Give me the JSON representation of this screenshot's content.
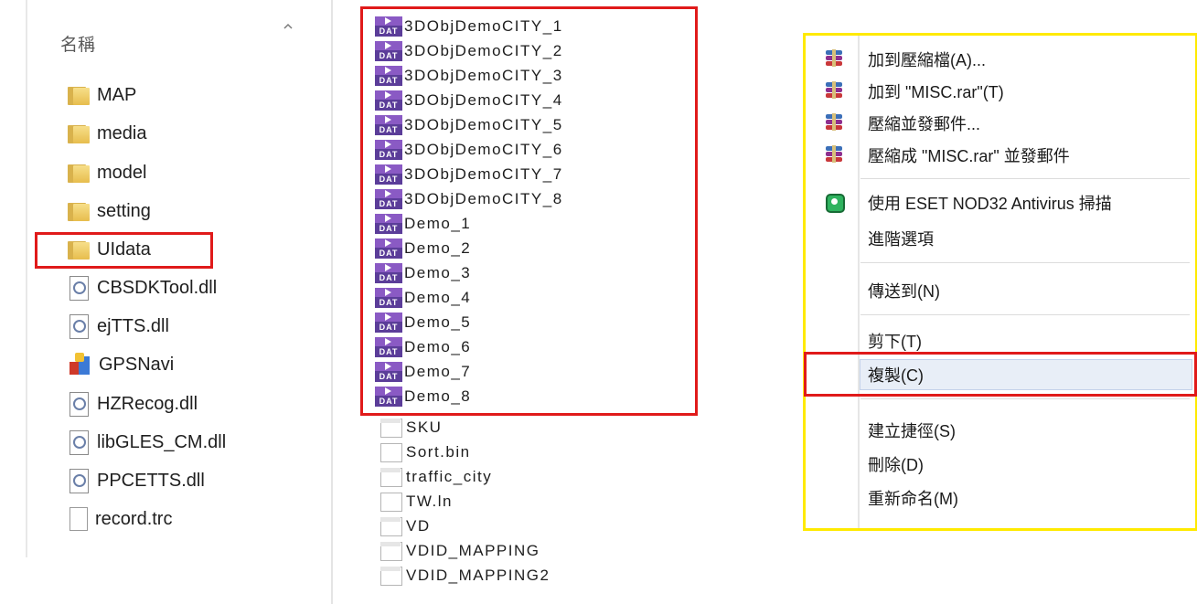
{
  "left_panel": {
    "column_header": "名稱",
    "items": [
      {
        "label": "MAP",
        "icon": "folder-icon",
        "kind": "folder"
      },
      {
        "label": "media",
        "icon": "folder-icon",
        "kind": "folder"
      },
      {
        "label": "model",
        "icon": "folder-icon",
        "kind": "folder"
      },
      {
        "label": "setting",
        "icon": "folder-icon",
        "kind": "folder"
      },
      {
        "label": "UIdata",
        "icon": "folder-icon",
        "kind": "folder",
        "highlighted": true
      },
      {
        "label": "CBSDKTool.dll",
        "icon": "dll-file-icon",
        "kind": "dll"
      },
      {
        "label": "ejTTS.dll",
        "icon": "dll-file-icon",
        "kind": "dll"
      },
      {
        "label": "GPSNavi",
        "icon": "application-icon",
        "kind": "exe"
      },
      {
        "label": "HZRecog.dll",
        "icon": "dll-file-icon",
        "kind": "dll"
      },
      {
        "label": "libGLES_CM.dll",
        "icon": "dll-file-icon",
        "kind": "dll"
      },
      {
        "label": "PPCETTS.dll",
        "icon": "dll-file-icon",
        "kind": "dll"
      },
      {
        "label": "record.trc",
        "icon": "file-icon",
        "kind": "file"
      }
    ]
  },
  "middle_panel": {
    "dat_icon_text": "DAT",
    "dat_files": [
      "3DObjDemoCITY_1",
      "3DObjDemoCITY_2",
      "3DObjDemoCITY_3",
      "3DObjDemoCITY_4",
      "3DObjDemoCITY_5",
      "3DObjDemoCITY_6",
      "3DObjDemoCITY_7",
      "3DObjDemoCITY_8",
      "Demo_1",
      "Demo_2",
      "Demo_3",
      "Demo_4",
      "Demo_5",
      "Demo_6",
      "Demo_7",
      "Demo_8"
    ],
    "other_files": [
      "SKU",
      "Sort.bin",
      "traffic_city",
      "TW.ln",
      "VD",
      "VDID_MAPPING",
      "VDID_MAPPING2"
    ]
  },
  "context_menu": {
    "groups": [
      [
        {
          "label": "加到壓縮檔(A)...",
          "icon": "winrar-icon"
        },
        {
          "label": "加到 \"MISC.rar\"(T)",
          "icon": "winrar-icon"
        },
        {
          "label": "壓縮並發郵件...",
          "icon": "winrar-icon"
        },
        {
          "label": "壓縮成 \"MISC.rar\" 並發郵件",
          "icon": "winrar-icon"
        }
      ],
      [
        {
          "label": "使用 ESET NOD32 Antivirus 掃描",
          "icon": "eset-icon"
        },
        {
          "label": "進階選項",
          "icon": ""
        }
      ],
      [
        {
          "label": "傳送到(N)",
          "icon": ""
        }
      ],
      [
        {
          "label": "剪下(T)",
          "icon": ""
        },
        {
          "label": "複製(C)",
          "icon": "",
          "highlighted": true
        }
      ],
      [
        {
          "label": "建立捷徑(S)",
          "icon": ""
        },
        {
          "label": "刪除(D)",
          "icon": ""
        },
        {
          "label": "重新命名(M)",
          "icon": ""
        }
      ]
    ]
  },
  "colors": {
    "highlight_border": "#e01a1a",
    "menu_border": "#ffea00",
    "dat_icon": "#5b3d99",
    "folder": "#e7bd4d"
  }
}
